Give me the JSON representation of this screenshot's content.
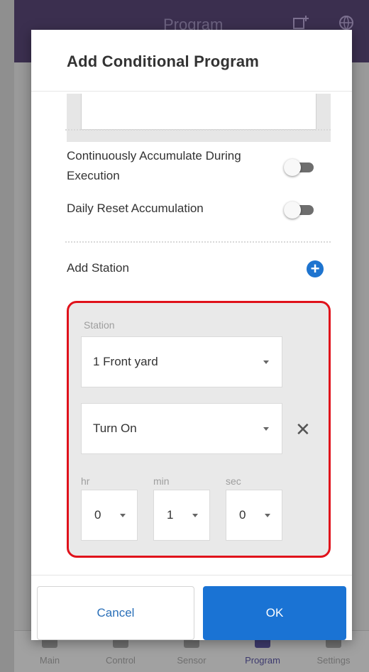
{
  "background": {
    "header_title": "Program",
    "header_icons": [
      "add-chart-icon",
      "globe-icon"
    ],
    "nav": [
      {
        "label": "Main",
        "icon": "home-icon"
      },
      {
        "label": "Control",
        "icon": "control-icon"
      },
      {
        "label": "Sensor",
        "icon": "sensor-icon"
      },
      {
        "label": "Program",
        "icon": "program-icon",
        "active": true
      },
      {
        "label": "Settings",
        "icon": "settings-icon"
      }
    ]
  },
  "dialog": {
    "title": "Add Conditional Program",
    "options": [
      {
        "label": "Continuously Accumulate During Execution",
        "enabled": false
      },
      {
        "label": "Daily Reset Accumulation",
        "enabled": false
      }
    ],
    "add_station_label": "Add Station",
    "station": {
      "label": "Station",
      "station_value": "1 Front yard",
      "action_value": "Turn On",
      "hr_label": "hr",
      "min_label": "min",
      "sec_label": "sec",
      "hr_value": "0",
      "min_value": "1",
      "sec_value": "0"
    },
    "cancel_label": "Cancel",
    "ok_label": "OK"
  },
  "colors": {
    "accent": "#1a73d4",
    "highlight": "#e0121b",
    "header": "#3b2f4f"
  }
}
